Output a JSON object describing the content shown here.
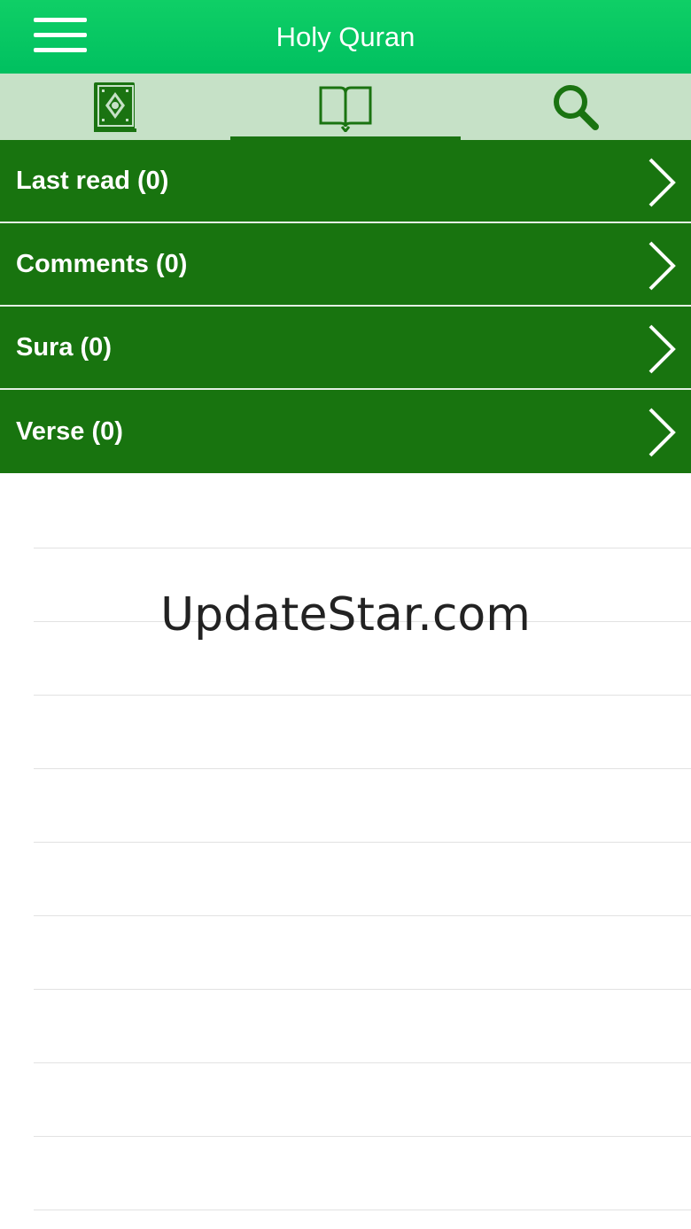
{
  "header": {
    "title": "Holy Quran",
    "menu_icon": "hamburger-menu-icon",
    "background": "#00c060"
  },
  "tabs": [
    {
      "icon": "quran-book-icon",
      "active": false
    },
    {
      "icon": "open-book-icon",
      "active": true
    },
    {
      "icon": "search-icon",
      "active": false
    }
  ],
  "bookmarks": [
    {
      "label": "Last read (0)",
      "icon": "chevron-right-icon"
    },
    {
      "label": "Comments (0)",
      "icon": "chevron-right-icon"
    },
    {
      "label": "Sura (0)",
      "icon": "chevron-right-icon"
    },
    {
      "label": "Verse (0)",
      "icon": "chevron-right-icon"
    }
  ],
  "watermark": "UpdateStar.com",
  "colors": {
    "accent": "#18740f",
    "tabbar": "#c6e1c7",
    "header": "#00c060"
  }
}
